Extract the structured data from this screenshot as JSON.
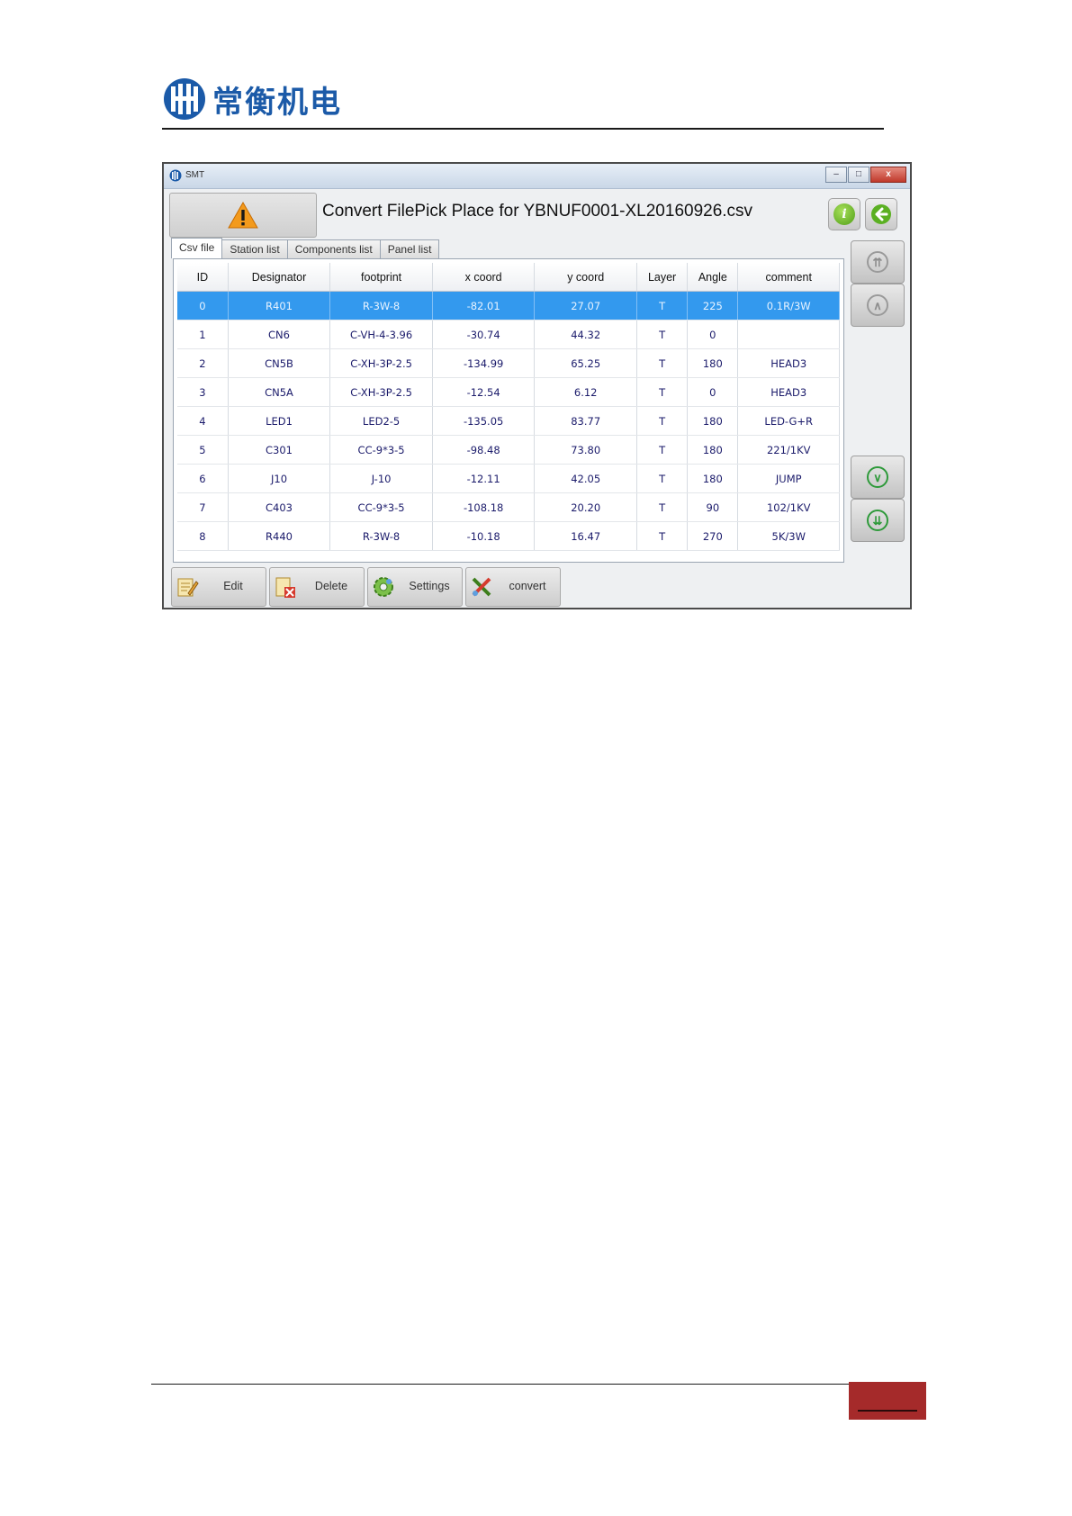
{
  "brand": {
    "name": "常衡机电",
    "color": "#1b5aa8"
  },
  "window": {
    "app_title": "SMT",
    "controls": {
      "minimize": "–",
      "maximize": "□",
      "close": "x"
    }
  },
  "dialog": {
    "title": "Convert FilePick Place for YBNUF0001-XL20160926.csv",
    "warning_icon": "warning-icon",
    "info_icon": "info-icon",
    "back_icon": "back-arrow-icon"
  },
  "tabs": [
    {
      "label": "Csv file",
      "active": true
    },
    {
      "label": "Station list",
      "active": false
    },
    {
      "label": "Components list",
      "active": false
    },
    {
      "label": "Panel list",
      "active": false
    }
  ],
  "table": {
    "columns": [
      "ID",
      "Designator",
      "footprint",
      "x coord",
      "y coord",
      "Layer",
      "Angle",
      "comment"
    ],
    "selected_index": 0,
    "selection_color": "#3399ee",
    "rows": [
      [
        "0",
        "R401",
        "R-3W-8",
        "-82.01",
        "27.07",
        "T",
        "225",
        "0.1R/3W"
      ],
      [
        "1",
        "CN6",
        "C-VH-4-3.96",
        "-30.74",
        "44.32",
        "T",
        "0",
        ""
      ],
      [
        "2",
        "CN5B",
        "C-XH-3P-2.5",
        "-134.99",
        "65.25",
        "T",
        "180",
        "HEAD3"
      ],
      [
        "3",
        "CN5A",
        "C-XH-3P-2.5",
        "-12.54",
        "6.12",
        "T",
        "0",
        "HEAD3"
      ],
      [
        "4",
        "LED1",
        "LED2-5",
        "-135.05",
        "83.77",
        "T",
        "180",
        "LED-G+R"
      ],
      [
        "5",
        "C301",
        "CC-9*3-5",
        "-98.48",
        "73.80",
        "T",
        "180",
        "221/1KV"
      ],
      [
        "6",
        "J10",
        "J-10",
        "-12.11",
        "42.05",
        "T",
        "180",
        "JUMP"
      ],
      [
        "7",
        "C403",
        "CC-9*3-5",
        "-108.18",
        "20.20",
        "T",
        "90",
        "102/1KV"
      ],
      [
        "8",
        "R440",
        "R-3W-8",
        "-10.18",
        "16.47",
        "T",
        "270",
        "5K/3W"
      ]
    ]
  },
  "side_buttons": [
    "page-up-icon",
    "scroll-up-icon",
    "scroll-down-icon",
    "page-down-icon"
  ],
  "toolbar": {
    "edit": "Edit",
    "delete": "Delete",
    "settings": "Settings",
    "convert": "convert"
  },
  "footer": {
    "accent": "#a52a2a"
  }
}
